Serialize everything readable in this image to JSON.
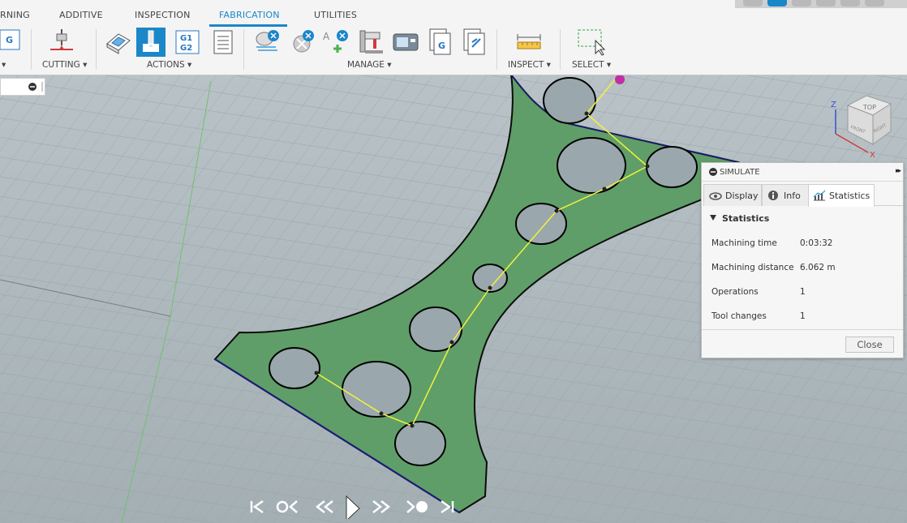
{
  "tabs": [
    {
      "label": "RNING"
    },
    {
      "label": "ADDITIVE"
    },
    {
      "label": "INSPECTION"
    },
    {
      "label": "FABRICATION"
    },
    {
      "label": "UTILITIES"
    }
  ],
  "toolbar_groups": {
    "first": "▾",
    "cutting": "CUTTING ▾",
    "actions": "ACTIONS ▾",
    "manage": "MANAGE ▾",
    "inspect": "INSPECT ▾",
    "select": "SELECT ▾"
  },
  "tool_text": {
    "g_icon": "G",
    "g1": "G1",
    "g2": "G2",
    "a_icon": "A",
    "g_file": "G",
    "viewcube_top": "TOP",
    "viewcube_front": "FRONT",
    "viewcube_right": "RIGHT",
    "axis_z": "Z",
    "axis_x": "X"
  },
  "simulate": {
    "title": "SIMULATE",
    "expand": "▸▸",
    "tabs": [
      {
        "label": "Display"
      },
      {
        "label": "Info"
      },
      {
        "label": "Statistics"
      }
    ],
    "section": "Statistics",
    "stats": [
      {
        "label": "Machining time",
        "value": "0:03:32"
      },
      {
        "label": "Machining distance",
        "value": "6.062 m"
      },
      {
        "label": "Operations",
        "value": "1"
      },
      {
        "label": "Tool changes",
        "value": "1"
      }
    ],
    "close": "Close"
  },
  "colors": {
    "accent": "#1a87c9",
    "part": "#5f9e68",
    "toolpath": "#f2f23a"
  }
}
